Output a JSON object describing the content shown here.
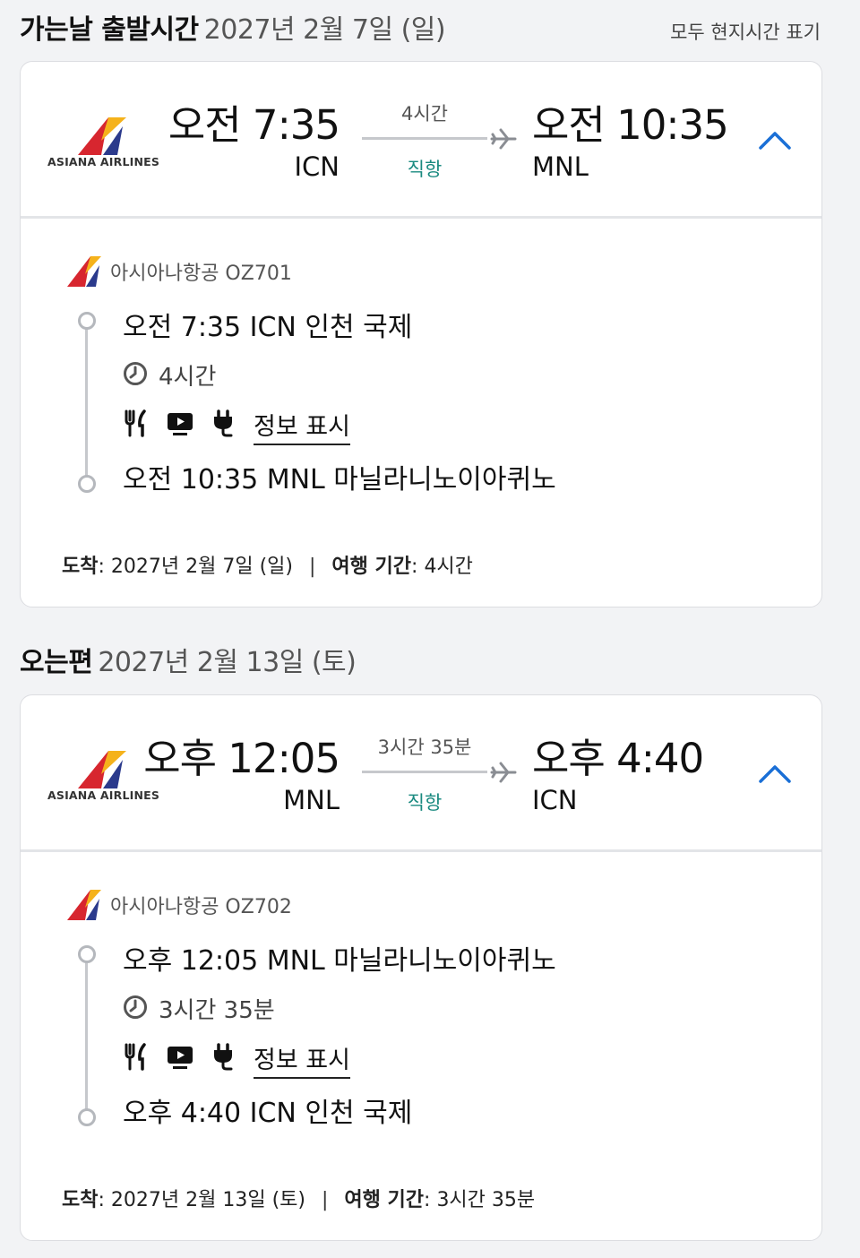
{
  "outbound": {
    "heading": "가는날 출발시간",
    "date": "2027년 2월 7일 (일)",
    "local_time_note": "모두 현지시간 표기",
    "airline_logo_text": "ASIANA AIRLINES",
    "dep_time": "오전 7:35",
    "dep_code": "ICN",
    "arr_time": "오전 10:35",
    "arr_code": "MNL",
    "duration": "4시간",
    "stops": "직항",
    "carrier": "아시아나항공 OZ701",
    "dep_stop": "오전 7:35 ICN 인천 국제",
    "flight_duration": "4시간",
    "info_link": "정보 표시",
    "arr_stop": "오전 10:35 MNL 마닐라니노이아퀴노",
    "arrival_label": "도착",
    "arrival_value": "2027년 2월 7일 (일)",
    "trip_label": "여행 기간",
    "trip_value": "4시간"
  },
  "inbound": {
    "heading": "오는편",
    "date": "2027년 2월 13일 (토)",
    "airline_logo_text": "ASIANA AIRLINES",
    "dep_time": "오후 12:05",
    "dep_code": "MNL",
    "arr_time": "오후 4:40",
    "arr_code": "ICN",
    "duration": "3시간 35분",
    "stops": "직항",
    "carrier": "아시아나항공 OZ702",
    "dep_stop": "오후 12:05 MNL 마닐라니노이아퀴노",
    "flight_duration": "3시간 35분",
    "info_link": "정보 표시",
    "arr_stop": "오후 4:40 ICN 인천 국제",
    "arrival_label": "도착",
    "arrival_value": "2027년 2월 13일 (토)",
    "trip_label": "여행 기간",
    "trip_value": "3시간 35분"
  },
  "colors": {
    "accent_blue": "#1a6fd6",
    "direct_teal": "#1a8a80",
    "asiana_red": "#d7262f",
    "asiana_yellow": "#f5b21b",
    "asiana_navy": "#2b3a8c"
  },
  "icons": [
    "asiana-logo-icon",
    "plane-icon",
    "chevron-up-icon",
    "clock-icon",
    "meal-icon",
    "tv-icon",
    "power-plug-icon"
  ]
}
